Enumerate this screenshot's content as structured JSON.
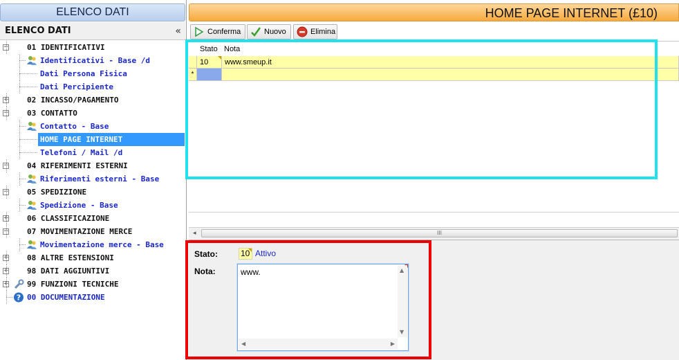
{
  "left_panel": {
    "top_title": "ELENCO DATI",
    "header_title": "ELENCO DATI",
    "collapse_glyph": "«",
    "tree": [
      {
        "label": "01 IDENTIFICATIVI",
        "level": 0,
        "expander": "−"
      },
      {
        "label": "Identificativi - Base /d",
        "level": 1,
        "icon": "users-icon"
      },
      {
        "label": "Dati Persona Fisica",
        "level": 1
      },
      {
        "label": "Dati Percipiente",
        "level": 1
      },
      {
        "label": "02 INCASSO/PAGAMENTO",
        "level": 0,
        "expander": "+"
      },
      {
        "label": "03 CONTATTO",
        "level": 0,
        "expander": "−"
      },
      {
        "label": "Contatto - Base",
        "level": 1,
        "icon": "users-icon"
      },
      {
        "label": "HOME PAGE INTERNET",
        "level": 1,
        "selected": true
      },
      {
        "label": "Telefoni / Mail /d",
        "level": 1
      },
      {
        "label": "04 RIFERIMENTI ESTERNI",
        "level": 0,
        "expander": "−"
      },
      {
        "label": "Riferimenti esterni - Base",
        "level": 1,
        "icon": "users-icon"
      },
      {
        "label": "05 SPEDIZIONE",
        "level": 0,
        "expander": "−"
      },
      {
        "label": "Spedizione - Base",
        "level": 1,
        "icon": "users-icon"
      },
      {
        "label": "06 CLASSIFICAZIONE",
        "level": 0,
        "expander": "+"
      },
      {
        "label": "07 MOVIMENTAZIONE MERCE",
        "level": 0,
        "expander": "−"
      },
      {
        "label": "Movimentazione merce - Base",
        "level": 1,
        "icon": "users-icon"
      },
      {
        "label": "08 ALTRE ESTENSIONI",
        "level": 0,
        "expander": "+"
      },
      {
        "label": "98 DATI AGGIUNTIVI",
        "level": 0,
        "expander": "+"
      },
      {
        "label": "99 FUNZIONI TECNICHE",
        "level": 0,
        "expander": "+",
        "icon": "wrench-icon"
      },
      {
        "label": "00 DOCUMENTAZIONE",
        "level": 0,
        "icon": "help-icon",
        "blue": true
      }
    ]
  },
  "right_panel": {
    "title": "HOME PAGE INTERNET (£10)",
    "toolbar": {
      "confirm_label": "Conferma",
      "new_label": "Nuovo",
      "delete_label": "Elimina"
    },
    "grid": {
      "columns": [
        "Stato",
        "Nota"
      ],
      "rows": [
        {
          "stato": "10",
          "nota": "www.smeup.it"
        }
      ],
      "new_row_marker": "*"
    },
    "scrollbar_grip": "III",
    "form": {
      "stato_label": "Stato:",
      "stato_value": "10",
      "stato_desc": "Attivo",
      "nota_label": "Nota:",
      "nota_value": "www."
    }
  },
  "colors": {
    "left_header": "#c8daf2",
    "right_header": "#f6a93d",
    "selection": "#3399ff",
    "highlight_cyan": "#20e2ee",
    "highlight_red": "#ee0000",
    "row_yellow": "#ffffa8"
  }
}
